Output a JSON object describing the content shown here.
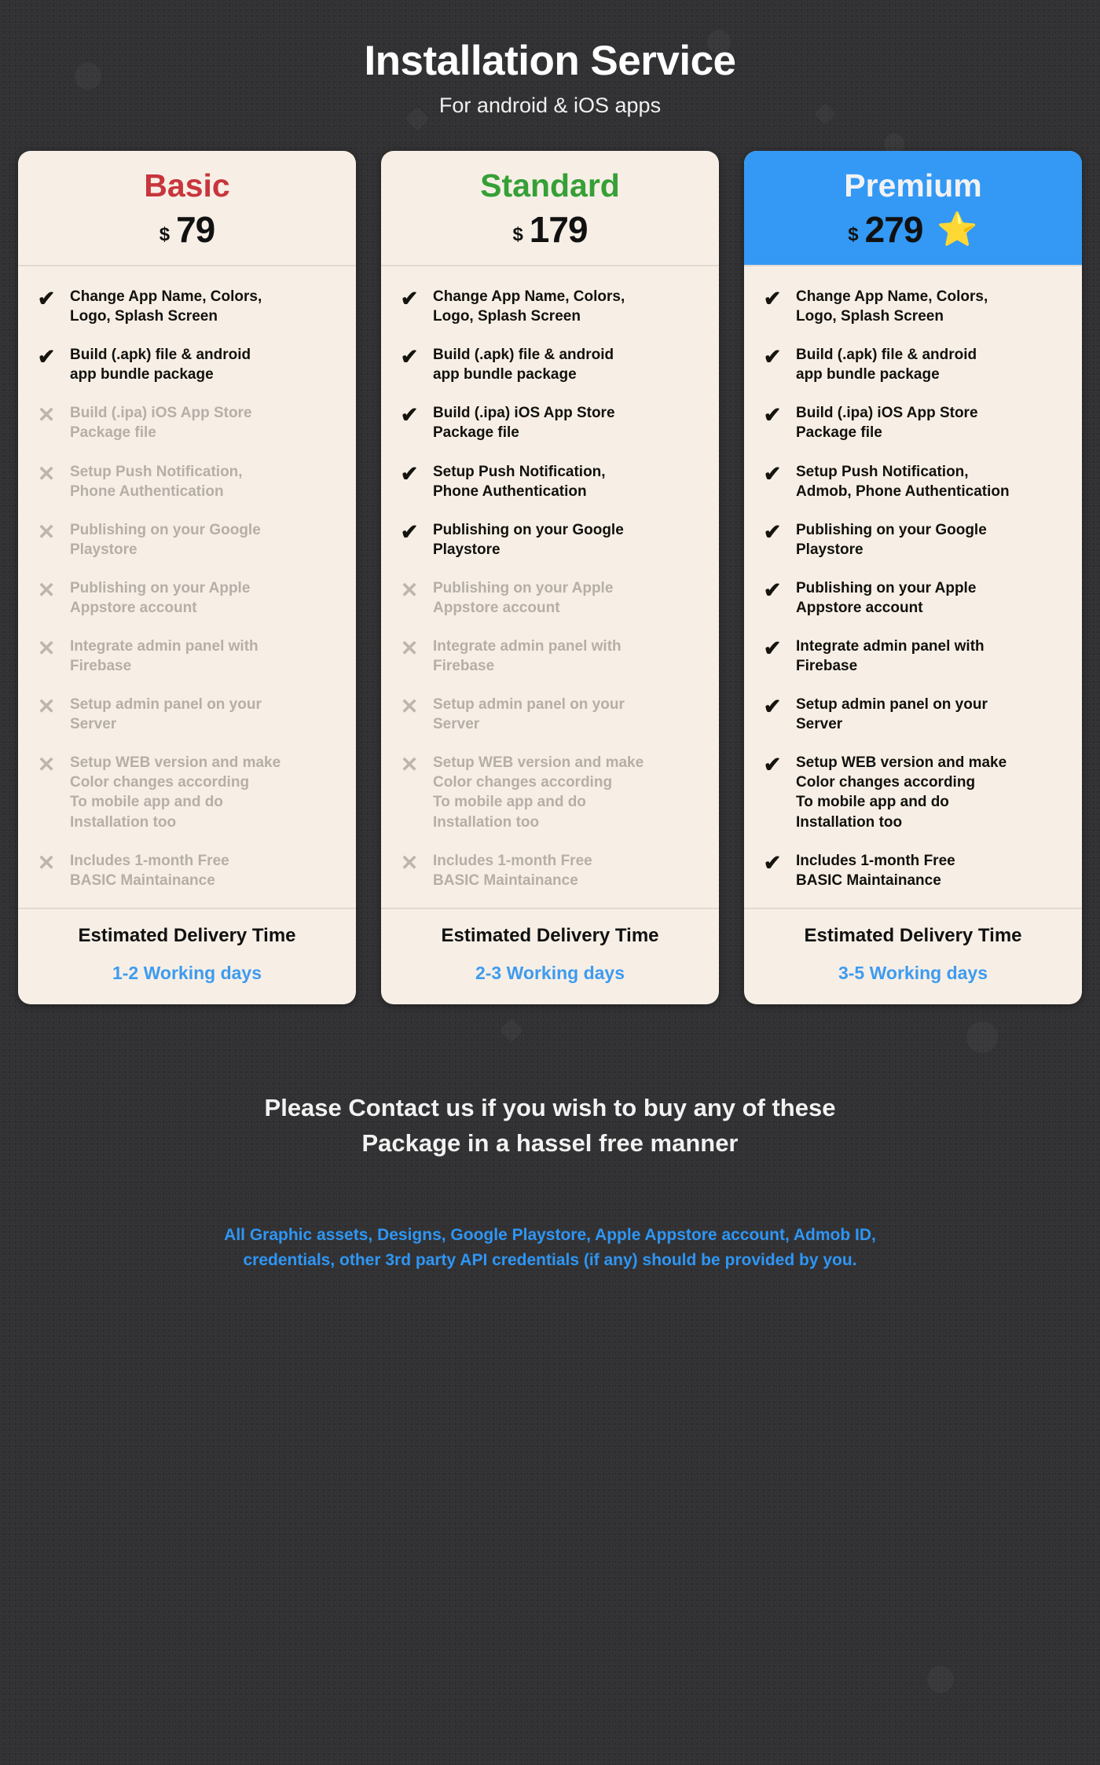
{
  "header": {
    "title": "Installation Service",
    "subtitle": "For android & iOS apps"
  },
  "colors": {
    "background": "#323234",
    "card_background": "#F7EFE6",
    "basic_accent": "#C9353C",
    "standard_accent": "#35A036",
    "premium_accent": "#3399F5",
    "link_blue": "#3D9BF0",
    "disabled_text": "#b6afa7"
  },
  "icons": {
    "check": "✔",
    "cross": "✕",
    "star": "⭐"
  },
  "plans": [
    {
      "name": "Basic",
      "currency": "$",
      "price": "79",
      "highlighted": false,
      "star": "",
      "features": [
        {
          "included": true,
          "text": "Change App Name, Colors,\nLogo, Splash Screen"
        },
        {
          "included": true,
          "text": "Build (.apk) file & android\napp bundle package"
        },
        {
          "included": false,
          "text": "Build (.ipa) iOS App Store\nPackage file"
        },
        {
          "included": false,
          "text": "Setup Push Notification,\nPhone Authentication"
        },
        {
          "included": false,
          "text": "Publishing on your Google\nPlaystore"
        },
        {
          "included": false,
          "text": "Publishing on your Apple\nAppstore account"
        },
        {
          "included": false,
          "text": "Integrate admin panel with\nFirebase"
        },
        {
          "included": false,
          "text": "Setup admin panel on your\nServer"
        },
        {
          "included": false,
          "text": "Setup WEB version and make\nColor changes according\nTo mobile app and do\nInstallation too"
        },
        {
          "included": false,
          "text": "Includes 1-month Free\nBASIC Maintainance"
        }
      ],
      "delivery_label": "Estimated Delivery Time",
      "delivery_value": "1-2 Working days"
    },
    {
      "name": "Standard",
      "currency": "$",
      "price": "179",
      "highlighted": false,
      "star": "",
      "features": [
        {
          "included": true,
          "text": "Change App Name, Colors,\nLogo, Splash Screen"
        },
        {
          "included": true,
          "text": "Build (.apk) file & android\napp bundle package"
        },
        {
          "included": true,
          "text": "Build (.ipa) iOS App Store\nPackage file"
        },
        {
          "included": true,
          "text": "Setup Push Notification,\nPhone Authentication"
        },
        {
          "included": true,
          "text": "Publishing on your Google\nPlaystore"
        },
        {
          "included": false,
          "text": "Publishing on your Apple\nAppstore account"
        },
        {
          "included": false,
          "text": "Integrate admin panel with\nFirebase"
        },
        {
          "included": false,
          "text": "Setup admin panel on your\nServer"
        },
        {
          "included": false,
          "text": "Setup WEB version and make\nColor changes according\nTo mobile app and do\nInstallation too"
        },
        {
          "included": false,
          "text": "Includes 1-month Free\nBASIC Maintainance"
        }
      ],
      "delivery_label": "Estimated Delivery Time",
      "delivery_value": "2-3 Working days"
    },
    {
      "name": "Premium",
      "currency": "$",
      "price": "279",
      "highlighted": true,
      "star": "⭐",
      "features": [
        {
          "included": true,
          "text": "Change App Name, Colors,\nLogo, Splash Screen"
        },
        {
          "included": true,
          "text": "Build (.apk) file & android\napp bundle package"
        },
        {
          "included": true,
          "text": "Build (.ipa) iOS App Store\nPackage file"
        },
        {
          "included": true,
          "text": "Setup Push Notification,\nAdmob, Phone Authentication"
        },
        {
          "included": true,
          "text": "Publishing on your Google\nPlaystore"
        },
        {
          "included": true,
          "text": "Publishing on your Apple\nAppstore account"
        },
        {
          "included": true,
          "text": "Integrate admin panel with\nFirebase"
        },
        {
          "included": true,
          "text": "Setup admin panel on your\nServer"
        },
        {
          "included": true,
          "text": "Setup WEB version and make\nColor changes according\nTo mobile app and do\nInstallation too"
        },
        {
          "included": true,
          "text": "Includes 1-month Free\nBASIC Maintainance"
        }
      ],
      "delivery_label": "Estimated Delivery Time",
      "delivery_value": "3-5 Working days"
    }
  ],
  "footer": {
    "contact_line1": "Please Contact us if you wish to buy any of these",
    "contact_line2": "Package in a hassel free manner",
    "disclaimer_line1": "All Graphic assets, Designs, Google Playstore, Apple Appstore account, Admob ID,",
    "disclaimer_line2": "credentials, other 3rd party API credentials (if any) should be provided by you."
  }
}
